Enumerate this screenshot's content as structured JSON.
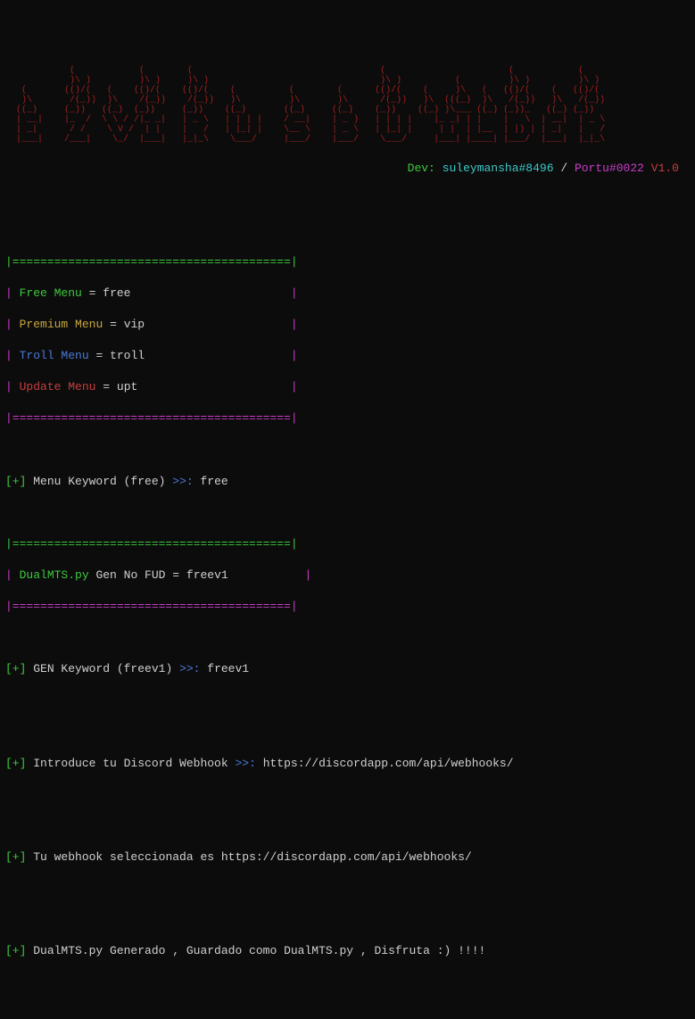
{
  "ascii_banner": "            (            (        (                                   (                       (            (      \n            )\\ )         )\\ )     )\\ )                                )\\ )          (         )\\ )         )\\ )   \n   (       (()/(   (    (()/(    (()/(    (          (        (      (()/(    (     )\\   (   (()/(    (   (()/(   \n   )\\       /(_))  )\\    /(_))    /(_))   )\\         )\\       )\\      /(_))   )\\  (((_)  )\\   /(_))   )\\   /(_))  \n  ((_)     (_))   ((_)  (_))     (_))    ((_)       ((_)     ((_)    (_))    ((_) )\\___ ((_) (_))_   ((_) (_))    \n  | __|    |_  /  \\ \\ / /|_ _|   | _ \\   | | | |    / __|    | _ )   | | | |    |_ _| | |    |   \\  | __|  | _ \\  \n  | _|      / /    \\ V /  | |    |   /   | |_| |    \\__ \\    | _ \\   | |_| |     | |  | |__  | |) | | _|   |   /  \n  |___|    /___|    \\_/  |___|   |_|_\\    \\___/     |___/    |___/    \\___/     |___| |____| |___/  |___|  |_|_\\  ",
  "dev_line": {
    "label": "Dev:",
    "dev1": "suleymansha#8496",
    "sep": "/",
    "dev2": "Portu#0022",
    "version": "V1.0"
  },
  "border": "|========================================|",
  "menu": [
    {
      "label": "Free Menu",
      "keyword": "free"
    },
    {
      "label": "Premium Menu",
      "keyword": "vip"
    },
    {
      "label": "Troll Menu",
      "keyword": "troll"
    },
    {
      "label": "Update Menu",
      "keyword": "upt"
    }
  ],
  "prompt1": {
    "marker": "[+]",
    "label": "Menu Keyword (free)",
    "arrows": ">>:",
    "input": "free"
  },
  "freesection": {
    "item": "DualMTS.py",
    "desc": "Gen No FUD",
    "eq": "=",
    "keyword": "freev1"
  },
  "prompt2": {
    "marker": "[+]",
    "label": "GEN Keyword (freev1)",
    "arrows": ">>:",
    "input": "freev1"
  },
  "prompt3": {
    "marker": "[+]",
    "label": "Introduce tu Discord Webhook",
    "arrows": ">>:",
    "input": "https://discordapp.com/api/webhooks/"
  },
  "status1": {
    "marker": "[+]",
    "text": "Tu webhook seleccionada es",
    "url": "https://discordapp.com/api/webhooks/"
  },
  "status2": {
    "marker": "[+]",
    "text": "DualMTS.py Generado , Guardado como DualMTS.py , Disfruta :) !!!!"
  }
}
